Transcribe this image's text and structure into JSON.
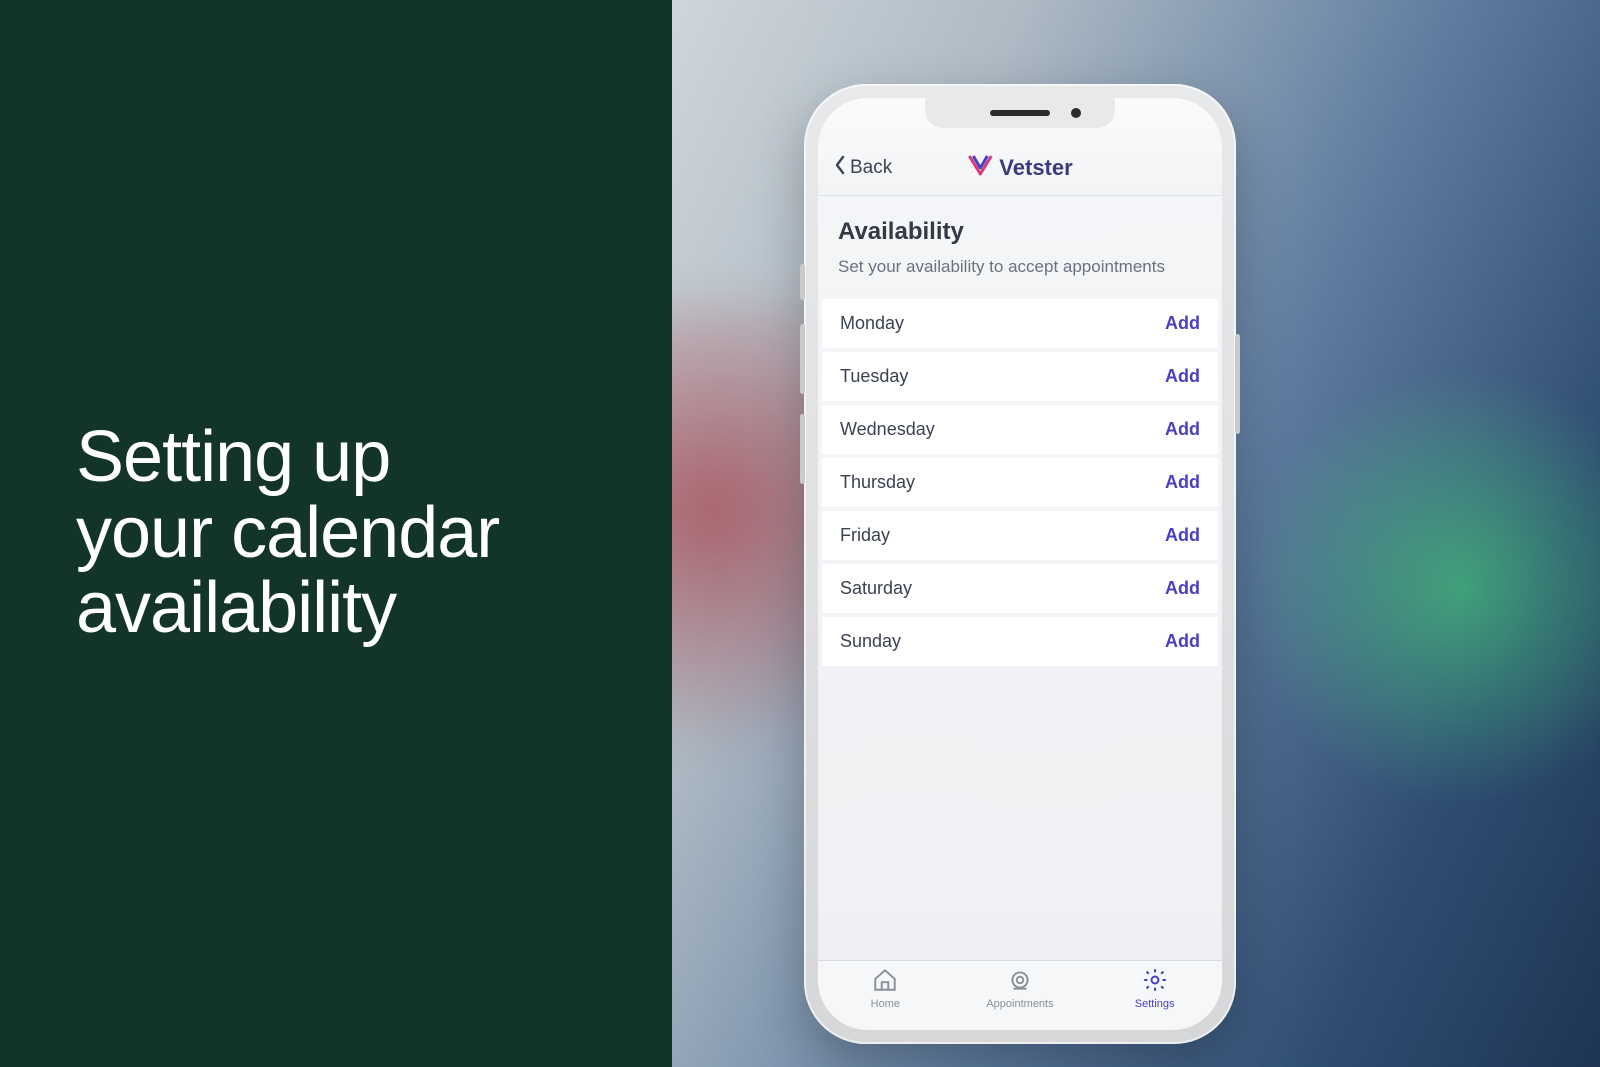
{
  "promo": {
    "headline_line1": "Setting up",
    "headline_line2": "your calendar",
    "headline_line3": "availability"
  },
  "nav": {
    "back_label": "Back",
    "brand_name": "Vetster"
  },
  "availability": {
    "title": "Availability",
    "subtitle": "Set your availability to accept appointments",
    "add_label": "Add",
    "days": [
      {
        "name": "Monday"
      },
      {
        "name": "Tuesday"
      },
      {
        "name": "Wednesday"
      },
      {
        "name": "Thursday"
      },
      {
        "name": "Friday"
      },
      {
        "name": "Saturday"
      },
      {
        "name": "Sunday"
      }
    ]
  },
  "tabs": {
    "home": "Home",
    "appointments": "Appointments",
    "settings": "Settings"
  },
  "colors": {
    "panel_bg": "#123429",
    "accent": "#4a3fc0"
  }
}
